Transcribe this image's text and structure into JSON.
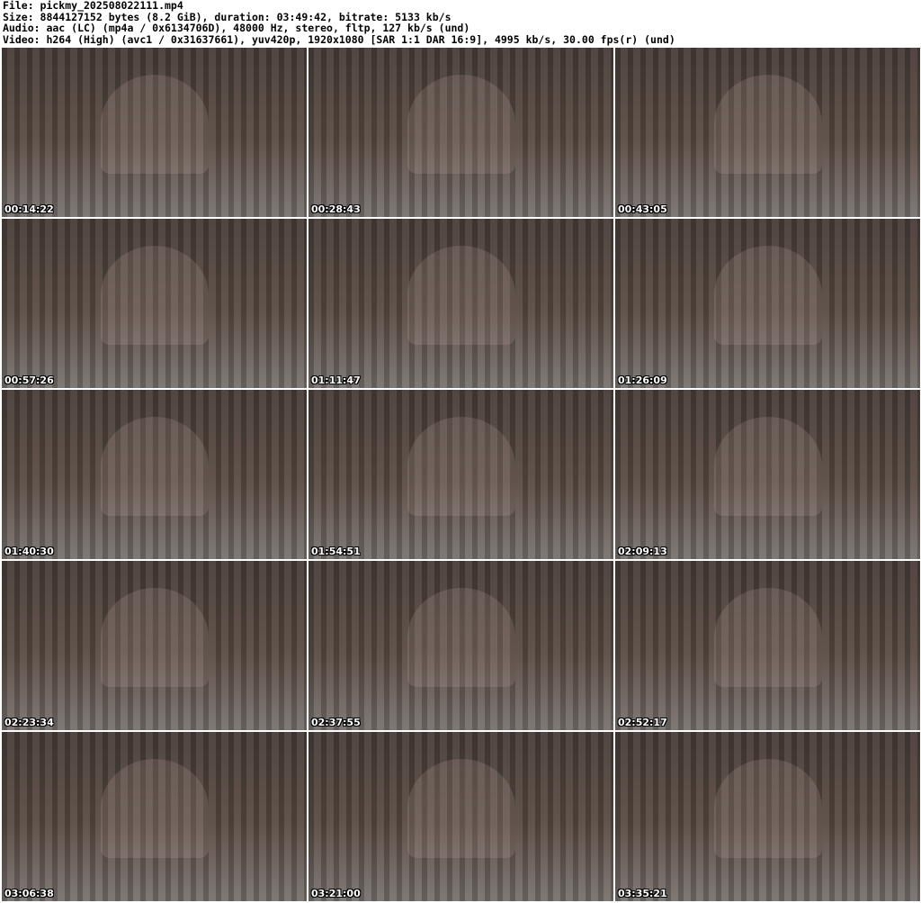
{
  "header": {
    "file": "File: pickmy_202508022111.mp4",
    "size": "Size: 8844127152 bytes (8.2 GiB), duration: 03:49:42, bitrate: 5133 kb/s",
    "audio": "Audio: aac (LC) (mp4a / 0x6134706D), 48000 Hz, stereo, fltp, 127 kb/s (und)",
    "video": "Video: h264 (High) (avc1 / 0x31637661), yuv420p, 1920x1080 [SAR 1:1 DAR 16:9], 4995 kb/s, 30.00 fps(r) (und)"
  },
  "thumbnails": [
    {
      "timestamp": "00:14:22"
    },
    {
      "timestamp": "00:28:43"
    },
    {
      "timestamp": "00:43:05"
    },
    {
      "timestamp": "00:57:26"
    },
    {
      "timestamp": "01:11:47"
    },
    {
      "timestamp": "01:26:09"
    },
    {
      "timestamp": "01:40:30"
    },
    {
      "timestamp": "01:54:51"
    },
    {
      "timestamp": "02:09:13"
    },
    {
      "timestamp": "02:23:34"
    },
    {
      "timestamp": "02:37:55"
    },
    {
      "timestamp": "02:52:17"
    },
    {
      "timestamp": "03:06:38"
    },
    {
      "timestamp": "03:21:00"
    },
    {
      "timestamp": "03:35:21"
    }
  ]
}
